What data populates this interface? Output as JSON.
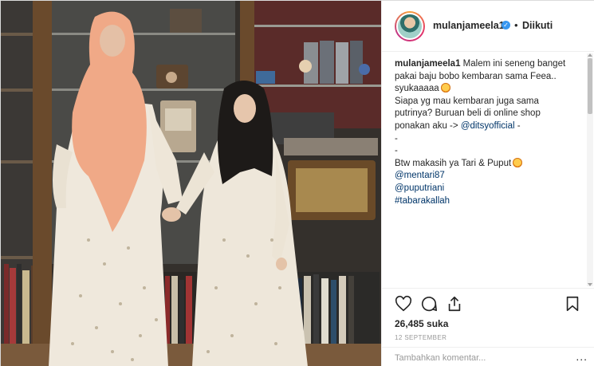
{
  "post": {
    "username": "mulanjameela1",
    "separator": "•",
    "follow_status": "Diikuti",
    "verified_icon": "verified-badge-icon",
    "caption_lines": [
      "Malem ini seneng banget",
      "pakai baju bobo kembaran sama Feea..",
      "syukaaaaa",
      "Siapa yg mau kembaran juga sama",
      "putrinya? Buruan beli di online shop",
      "ponakan aku ->",
      "-",
      "-",
      "Btw makasih ya Tari & Puput"
    ],
    "mentions": {
      "ditsy": "@ditsyofficial",
      "ditsy_suffix": " -",
      "mentari": "@mentari87",
      "puputriani": "@puputriani",
      "hashtag": "#tabarakallah"
    },
    "likes": "26,485 suka",
    "date": "12 SEPTEMBER",
    "comment_placeholder": "Tambahkan komentar...",
    "more_label": "..."
  },
  "icons": {
    "like": "heart-icon",
    "comment": "comment-icon",
    "share": "share-icon",
    "save": "bookmark-icon"
  },
  "colors": {
    "link": "#003569",
    "verified": "#3897f0",
    "text": "#262626",
    "muted": "#999999",
    "border": "#dbdbdb"
  }
}
